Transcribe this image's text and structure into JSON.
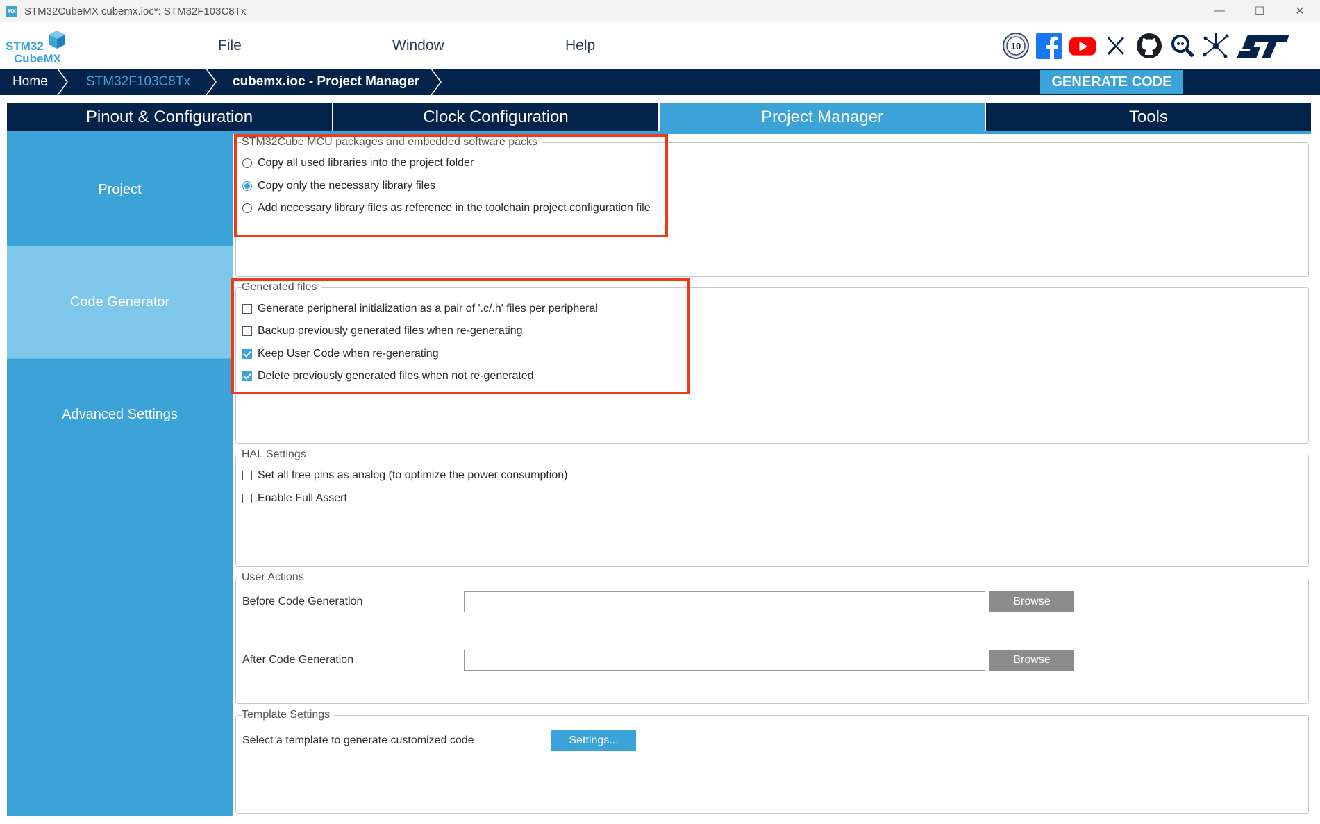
{
  "window": {
    "title": "STM32CubeMX cubemx.ioc*: STM32F103C8Tx",
    "app_icon_text": "MX",
    "controls": {
      "minimize": "—",
      "maximize": "☐",
      "close": "✕"
    }
  },
  "logo": {
    "line1": "STM32",
    "line2": "CubeMX"
  },
  "menu": {
    "file": "File",
    "window": "Window",
    "help": "Help"
  },
  "social_icons": [
    "anniversary-10-icon",
    "facebook-icon",
    "youtube-icon",
    "x-icon",
    "github-icon",
    "community-search-icon",
    "network-icon",
    "st-logo-icon"
  ],
  "badge_text": "10",
  "breadcrumb": {
    "home": "Home",
    "mcu": "STM32F103C8Tx",
    "current": "cubemx.ioc - Project Manager"
  },
  "generate_button": "GENERATE CODE",
  "tabs": {
    "pinout": "Pinout & Configuration",
    "clock": "Clock Configuration",
    "project_manager": "Project Manager",
    "tools": "Tools"
  },
  "sidenav": {
    "project": "Project",
    "code_generator": "Code Generator",
    "advanced": "Advanced Settings"
  },
  "packages": {
    "legend": "STM32Cube MCU packages and embedded software packs",
    "options": [
      "Copy all used libraries into the project folder",
      "Copy only the necessary library files",
      "Add necessary library files as reference in the toolchain project configuration file"
    ],
    "selected_index": 1
  },
  "generated_files": {
    "legend": "Generated files",
    "options": [
      "Generate peripheral initialization as a pair of '.c/.h' files per peripheral",
      "Backup previously generated files when re-generating",
      "Keep User Code when re-generating",
      "Delete previously generated files when not re-generated"
    ],
    "checked": [
      false,
      false,
      true,
      true
    ]
  },
  "hal_settings": {
    "legend": "HAL Settings",
    "options": [
      "Set all free pins as analog (to optimize the power consumption)",
      "Enable Full Assert"
    ],
    "checked": [
      false,
      false
    ]
  },
  "user_actions": {
    "legend": "User Actions",
    "before_label": "Before Code Generation",
    "before_value": "",
    "after_label": "After Code Generation",
    "after_value": "",
    "browse": "Browse"
  },
  "template_settings": {
    "legend": "Template Settings",
    "label": "Select a template to generate customized code",
    "button": "Settings..."
  },
  "colors": {
    "navy": "#03234b",
    "accent": "#3ca3d9",
    "active_side": "#7ec6ea",
    "highlight": "#f03a17"
  }
}
